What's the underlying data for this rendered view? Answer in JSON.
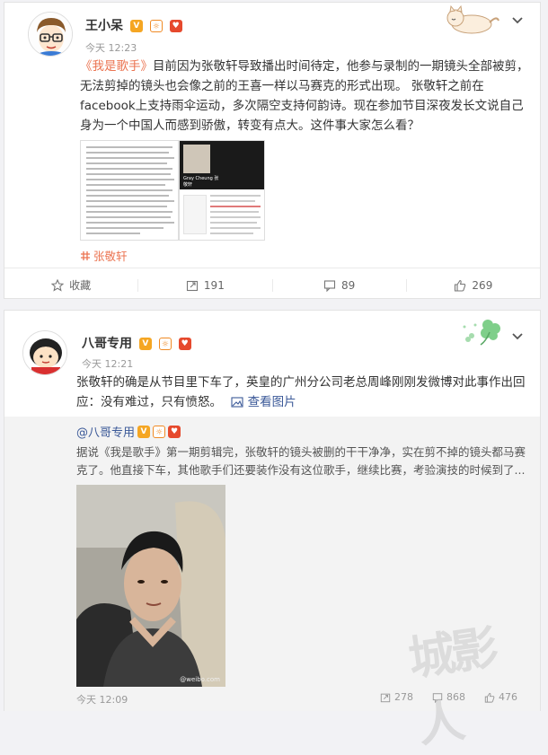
{
  "post1": {
    "username": "王小呆",
    "time": "今天 12:23",
    "text": {
      "title_link": "《我是歌手》",
      "body_a": "目前因为张敬轩导致播出时间待定，他参与录制的一期镜头全部被剪，无法剪掉的镜头也会像之前的王喜一样以马赛克的形式出现。 张敬轩之前在facebook上支持雨伞运动，多次隔空支持何韵诗。现在参加节目深夜发长文说自己身为一个中国人而感到骄傲，转变有点大。这件事大家怎么看？"
    },
    "image_caption": "Gray Cheung 张敬轩",
    "topic_tag": "张敬轩",
    "actions": {
      "collect_label": "收藏",
      "repost_count": "191",
      "comment_count": "89",
      "like_count": "269"
    }
  },
  "post2": {
    "username": "八哥专用",
    "time": "今天 12:21",
    "text_a": "张敬轩的确是从节目里下车了，英皇的广州分公司老总周峰刚刚发微博对此事作出回应：没有难过，只有愤怒。",
    "view_image_label": "查看图片",
    "repost": {
      "author": "@八哥专用",
      "text": "据说《我是歌手》第一期剪辑完，张敬轩的镜头被删的干干净净，实在剪不掉的镜头都马赛克了。他直接下车，其他歌手们还要装作没有这位歌手，继续比赛，考验演技的时候到了...",
      "photo_watermark": "@weibo.com",
      "time": "今天 12:09",
      "repost_count": "278",
      "comment_count": "868",
      "like_count": "476"
    }
  },
  "watermark_text": "城影人",
  "colors": {
    "accent": "#eb7350",
    "link_blue": "#3b5998"
  }
}
